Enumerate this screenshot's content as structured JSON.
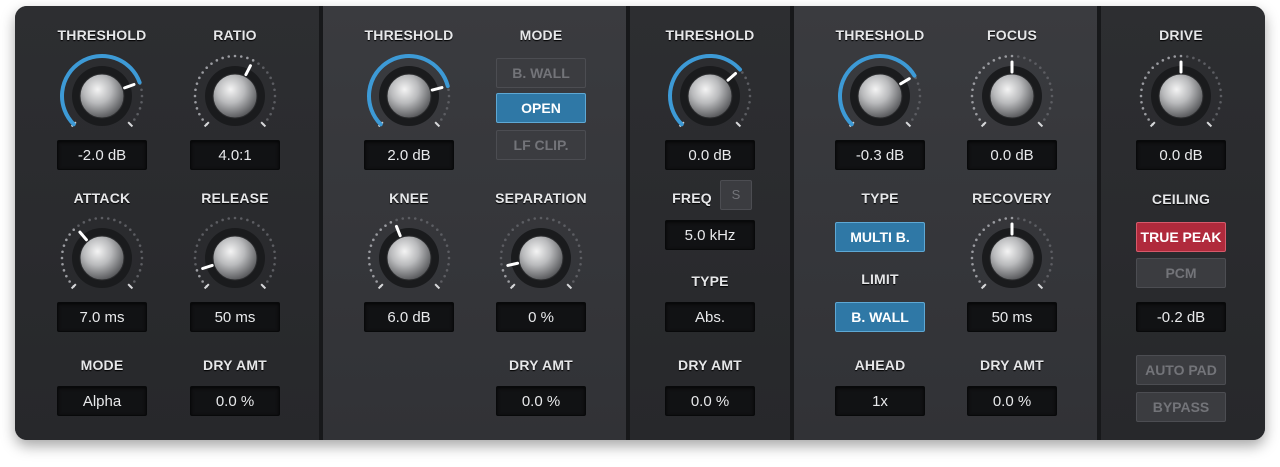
{
  "comp": {
    "threshold": {
      "label": "THRESHOLD",
      "value": "-2.0 dB",
      "position": 0.76
    },
    "ratio": {
      "label": "RATIO",
      "value": "4.0:1",
      "position": 0.6
    },
    "attack": {
      "label": "ATTACK",
      "value": "7.0 ms",
      "position": 0.35
    },
    "release": {
      "label": "RELEASE",
      "value": "50 ms",
      "position": 0.1
    },
    "mode": {
      "label": "MODE",
      "value": "Alpha"
    },
    "dry_amt": {
      "label": "DRY AMT",
      "value": "0.0 %"
    }
  },
  "clip": {
    "threshold": {
      "label": "THRESHOLD",
      "value": "2.0 dB",
      "position": 0.78
    },
    "mode": {
      "label": "MODE",
      "options": [
        "B. WALL",
        "OPEN",
        "LF CLIP."
      ],
      "selected": "OPEN"
    },
    "knee": {
      "label": "KNEE",
      "value": "6.0 dB",
      "position": 0.42
    },
    "separation": {
      "label": "SEPARATION",
      "value": "0 %",
      "position": 0.12
    },
    "dry_amt": {
      "label": "DRY AMT",
      "value": "0.0 %"
    }
  },
  "eq": {
    "threshold": {
      "label": "THRESHOLD",
      "value": "0.0 dB",
      "position": 0.68
    },
    "freq": {
      "label": "FREQ",
      "value": "5.0 kHz",
      "solo_label": "S"
    },
    "type": {
      "label": "TYPE",
      "value": "Abs."
    },
    "dry_amt": {
      "label": "DRY AMT",
      "value": "0.0 %"
    }
  },
  "limiter": {
    "threshold": {
      "label": "THRESHOLD",
      "value": "-0.3 dB",
      "position": 0.72
    },
    "focus": {
      "label": "FOCUS",
      "value": "0.0 dB",
      "position": 0.5
    },
    "type": {
      "label": "TYPE",
      "value": "MULTI B."
    },
    "recovery": {
      "label": "RECOVERY",
      "value": "50 ms",
      "position": 0.5
    },
    "limit": {
      "label": "LIMIT",
      "value": "B. WALL"
    },
    "ahead": {
      "label": "AHEAD",
      "value": "1x"
    },
    "dry_amt": {
      "label": "DRY AMT",
      "value": "0.0 %"
    }
  },
  "output": {
    "drive": {
      "label": "DRIVE",
      "value": "0.0 dB",
      "position": 0.5
    },
    "ceiling": {
      "label": "CEILING",
      "true_peak": "TRUE PEAK",
      "pcm": "PCM",
      "value": "-0.2 dB"
    },
    "auto_pad": "AUTO PAD",
    "bypass": "BYPASS"
  },
  "colors": {
    "accent_blue": "#2f78a6",
    "arc_blue": "#3d9ad6",
    "true_peak_red": "#b02a3c"
  }
}
